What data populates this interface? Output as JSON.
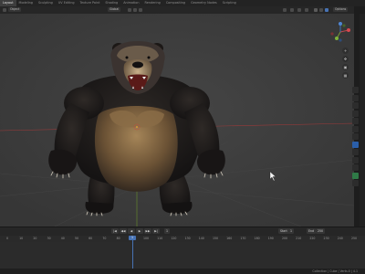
{
  "app": {
    "name": "Blender"
  },
  "workspace_tabs": [
    "Layout",
    "Modeling",
    "Sculpting",
    "UV Editing",
    "Texture Paint",
    "Shading",
    "Animation",
    "Rendering",
    "Compositing",
    "Geometry Nodes",
    "Scripting"
  ],
  "viewport_header": {
    "mode": "Object",
    "transform": "Global",
    "options": "Options"
  },
  "timeline": {
    "playback_buttons": [
      "|◀",
      "◀◀",
      "◀",
      "▶",
      "▶▶",
      "▶|"
    ],
    "current_frame": "1",
    "start_label": "Start",
    "start_value": "1",
    "end_label": "End",
    "end_value": "250",
    "ruler_ticks": [
      "0",
      "10",
      "20",
      "30",
      "40",
      "50",
      "60",
      "70",
      "80",
      "90",
      "100",
      "110",
      "120",
      "130",
      "140",
      "150",
      "160",
      "170",
      "180",
      "190",
      "200",
      "210",
      "220",
      "230",
      "240",
      "250"
    ]
  },
  "status": {
    "text": "Collection | Cube | Verts:0 | 4.1"
  },
  "colors": {
    "viewport_bg": "#3d3d3d",
    "accent": "#4772b3",
    "x_axis": "#9b3a3a",
    "y_axis": "#6a8f2a"
  },
  "icons": [
    "view-orbit-icon",
    "zoom-icon",
    "pan-icon",
    "camera-icon",
    "grid-icon"
  ]
}
